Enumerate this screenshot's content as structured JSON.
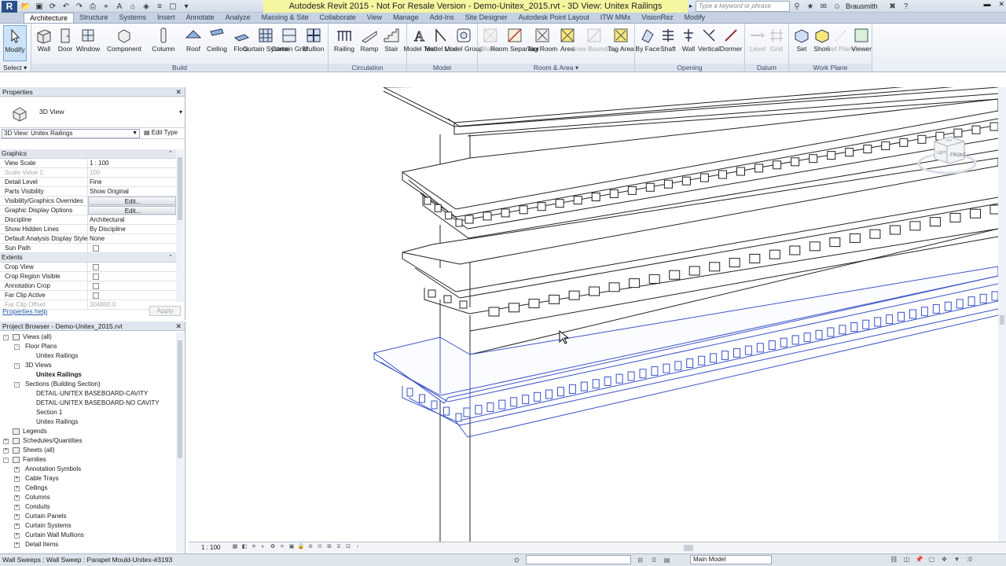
{
  "titlebar": {
    "logo": "R",
    "title": "Autodesk Revit 2015 - Not For Resale Version -     Demo-Unitex_2015.rvt - 3D View: Unitex Railings",
    "search_placeholder": "Type a keyword or phrase",
    "user": "Brausmith",
    "qat_icons": [
      "open-icon",
      "save-icon",
      "sync-icon",
      "undo-icon",
      "redo-icon",
      "print-icon",
      "measure-icon",
      "text-icon",
      "3d-view-icon",
      "section-icon",
      "thin-lines-icon",
      "close-hidden-icon",
      "switch-windows-icon"
    ]
  },
  "tabs": [
    {
      "label": "Architecture",
      "active": true
    },
    {
      "label": "Structure"
    },
    {
      "label": "Systems"
    },
    {
      "label": "Insert"
    },
    {
      "label": "Annotate"
    },
    {
      "label": "Analyze"
    },
    {
      "label": "Massing & Site"
    },
    {
      "label": "Collaborate"
    },
    {
      "label": "View"
    },
    {
      "label": "Manage"
    },
    {
      "label": "Add-Ins"
    },
    {
      "label": "Site Designer"
    },
    {
      "label": "Autodesk Point Layout"
    },
    {
      "label": "ITW MMx"
    },
    {
      "label": "VisionRez"
    },
    {
      "label": "Modify"
    }
  ],
  "ribbon": {
    "select_label": "Select",
    "modify_label": "Modify",
    "groups": {
      "build": "Build",
      "circulation": "Circulation",
      "model": "Model",
      "room_area": "Room & Area",
      "opening": "Opening",
      "datum": "Datum",
      "work_plane": "Work Plane"
    },
    "buttons": {
      "wall": "Wall",
      "door": "Door",
      "window": "Window",
      "component": "Component",
      "column": "Column",
      "roof": "Roof",
      "ceiling": "Ceiling",
      "floor": "Floor",
      "curtain_system": "Curtain System",
      "curtain_grid": "Curtain Grid",
      "mullion": "Mullion",
      "railing": "Railing",
      "ramp": "Ramp",
      "stair": "Stair",
      "model_text": "Model Text",
      "model_line": "Model Line",
      "model_group": "Model Group",
      "room": "Room",
      "room_separator": "Room Separator",
      "tag_room": "Tag Room",
      "area": "Area",
      "area_boundary": "Area Boundary",
      "tag_area": "Tag Area",
      "by_face": "By Face",
      "shaft": "Shaft",
      "wall_opening": "Wall",
      "vertical": "Vertical",
      "dormer": "Dormer",
      "level": "Level",
      "grid": "Grid",
      "set": "Set",
      "show": "Show",
      "ref_plane": "Ref Plane",
      "viewer": "Viewer"
    }
  },
  "properties": {
    "header": "Properties",
    "type_name": "3D View",
    "instance_selector": "3D View: Unitex Railings",
    "edit_type": "Edit Type",
    "sections": {
      "graphics": "Graphics",
      "extents": "Extents"
    },
    "rows": [
      {
        "name": "View Scale",
        "value": "1 : 100"
      },
      {
        "name": "Scale Value    1:",
        "value": "100"
      },
      {
        "name": "Detail Level",
        "value": "Fine"
      },
      {
        "name": "Parts Visibility",
        "value": "Show Original"
      },
      {
        "name": "Visibility/Graphics Overrides",
        "value": "Edit..."
      },
      {
        "name": "Graphic Display Options",
        "value": "Edit..."
      },
      {
        "name": "Discipline",
        "value": "Architectural"
      },
      {
        "name": "Show Hidden Lines",
        "value": "By Discipline"
      },
      {
        "name": "Default Analysis Display Style",
        "value": "None"
      },
      {
        "name": "Sun Path",
        "value": ""
      },
      {
        "name": "Crop View",
        "value": ""
      },
      {
        "name": "Crop Region Visible",
        "value": ""
      },
      {
        "name": "Annotation Crop",
        "value": ""
      },
      {
        "name": "Far Clip Active",
        "value": ""
      },
      {
        "name": "Far Clip Offset",
        "value": "304800.0"
      }
    ],
    "help_link": "Properties help",
    "apply": "Apply"
  },
  "browser": {
    "header": "Project Browser - Demo-Unitex_2015.rvt",
    "items": [
      {
        "label": "Views (all)",
        "level": 0,
        "exp": "-"
      },
      {
        "label": "Floor Plans",
        "level": 1,
        "exp": "-"
      },
      {
        "label": "Unitex Railings",
        "level": 2
      },
      {
        "label": "3D Views",
        "level": 1,
        "exp": "-"
      },
      {
        "label": "Unitex Railings",
        "level": 2,
        "bold": true
      },
      {
        "label": "Sections (Building Section)",
        "level": 1,
        "exp": "-"
      },
      {
        "label": "DETAIL-UNITEX BASEBOARD-CAVITY",
        "level": 2
      },
      {
        "label": "DETAIL-UNITEX BASEBOARD-NO CAVITY",
        "level": 2
      },
      {
        "label": "Section 1",
        "level": 2
      },
      {
        "label": "Unitex Railings",
        "level": 2
      },
      {
        "label": "Legends",
        "level": 0
      },
      {
        "label": "Schedules/Quantities",
        "level": 0,
        "exp": "+"
      },
      {
        "label": "Sheets (all)",
        "level": 0,
        "exp": "+"
      },
      {
        "label": "Families",
        "level": 0,
        "exp": "-"
      },
      {
        "label": "Annotation Symbols",
        "level": 1,
        "exp": "+"
      },
      {
        "label": "Cable Trays",
        "level": 1,
        "exp": "+"
      },
      {
        "label": "Ceilings",
        "level": 1,
        "exp": "+"
      },
      {
        "label": "Columns",
        "level": 1,
        "exp": "+"
      },
      {
        "label": "Conduits",
        "level": 1,
        "exp": "+"
      },
      {
        "label": "Curtain Panels",
        "level": 1,
        "exp": "+"
      },
      {
        "label": "Curtain Systems",
        "level": 1,
        "exp": "+"
      },
      {
        "label": "Curtain Wall Mullions",
        "level": 1,
        "exp": "+"
      },
      {
        "label": "Detail Items",
        "level": 1,
        "exp": "+"
      }
    ]
  },
  "view": {
    "scale": "1 : 100",
    "viewcube_face": "FRONT",
    "viewcube_side": "LEFT",
    "viewcube_top": "TOP",
    "highlight_color": "#3a52c8"
  },
  "status": {
    "text": "Wall Sweeps : Wall Sweep : Parapet Mould-Unitex-#3193",
    "active_model": "Main Model",
    "filter_count": ":0"
  }
}
